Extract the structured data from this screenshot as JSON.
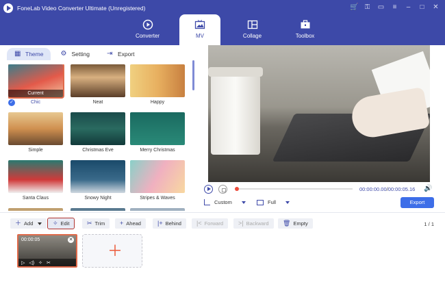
{
  "app": {
    "title": "FoneLab Video Converter Ultimate (Unregistered)"
  },
  "main_tabs": [
    {
      "label": "Converter",
      "icon": "converter-icon"
    },
    {
      "label": "MV",
      "icon": "mv-icon"
    },
    {
      "label": "Collage",
      "icon": "collage-icon"
    },
    {
      "label": "Toolbox",
      "icon": "toolbox-icon"
    }
  ],
  "sub_tabs": [
    {
      "label": "Theme",
      "icon": "theme-icon"
    },
    {
      "label": "Setting",
      "icon": "gear-icon"
    },
    {
      "label": "Export",
      "icon": "export-icon"
    }
  ],
  "themes": [
    {
      "label": "Chic",
      "current_label": "Current"
    },
    {
      "label": "Neat"
    },
    {
      "label": "Happy"
    },
    {
      "label": "Simple"
    },
    {
      "label": "Christmas Eve"
    },
    {
      "label": "Merry Christmas"
    },
    {
      "label": "Santa Claus"
    },
    {
      "label": "Snowy Night"
    },
    {
      "label": "Stripes & Waves"
    }
  ],
  "player": {
    "current_time": "00:00:00.00",
    "total_time": "00:00:05.16",
    "aspect_label": "Custom",
    "display_label": "Full",
    "export_label": "Export"
  },
  "toolbar": {
    "add": "Add",
    "edit": "Edit",
    "trim": "Trim",
    "ahead": "Ahead",
    "behind": "Behind",
    "forward": "Forward",
    "backward": "Backward",
    "empty": "Empty",
    "page_current": "1",
    "page_total": "1"
  },
  "timeline": {
    "clip_duration": "00:00:05"
  },
  "colors": {
    "brand": "#3d49a8",
    "accent": "#3d6ee8",
    "highlight": "#b0322e"
  }
}
